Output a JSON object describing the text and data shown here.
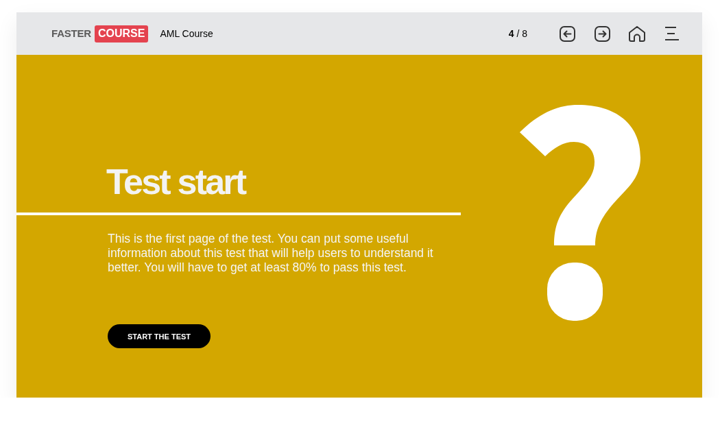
{
  "header": {
    "logo": {
      "text": "FASTER",
      "highlight": "COURSE"
    },
    "course_title": "AML Course",
    "page_counter": "**4** / 8"
  },
  "slide": {
    "title": "Test start",
    "description": "This is the first page of the test. You can put some useful information about this test that will help users to understand it better. You will have to get at least 80% to pass this test.",
    "button": "START THE TEST"
  }
}
